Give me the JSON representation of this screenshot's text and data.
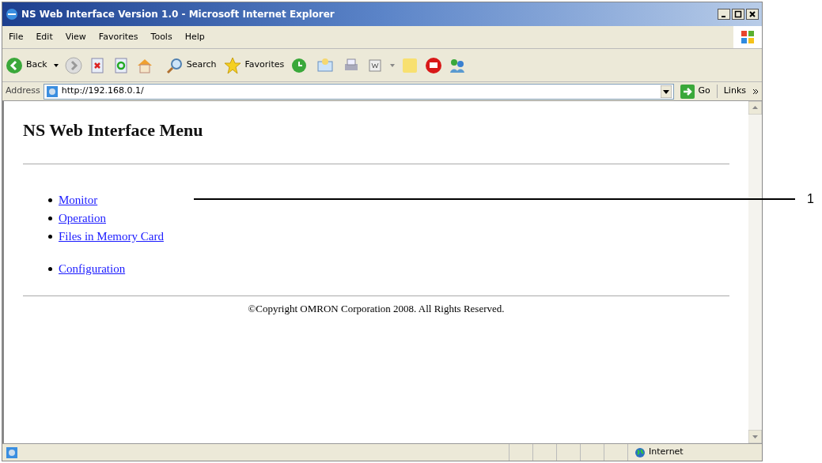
{
  "window": {
    "title": "NS Web Interface Version 1.0 - Microsoft Internet Explorer"
  },
  "menu": [
    "File",
    "Edit",
    "View",
    "Favorites",
    "Tools",
    "Help"
  ],
  "toolbar": {
    "back": "Back",
    "search": "Search",
    "favorites": "Favorites"
  },
  "address_bar": {
    "label": "Address",
    "value": "http://192.168.0.1/",
    "go": "Go",
    "links": "Links"
  },
  "page": {
    "heading": "NS Web Interface Menu",
    "link_groups": [
      [
        "Monitor",
        "Operation",
        "Files in Memory Card"
      ],
      [
        "Configuration"
      ]
    ],
    "footer": "©Copyright OMRON Corporation 2008. All Rights Reserved."
  },
  "status_bar": {
    "zone": "Internet"
  },
  "callout": "1"
}
